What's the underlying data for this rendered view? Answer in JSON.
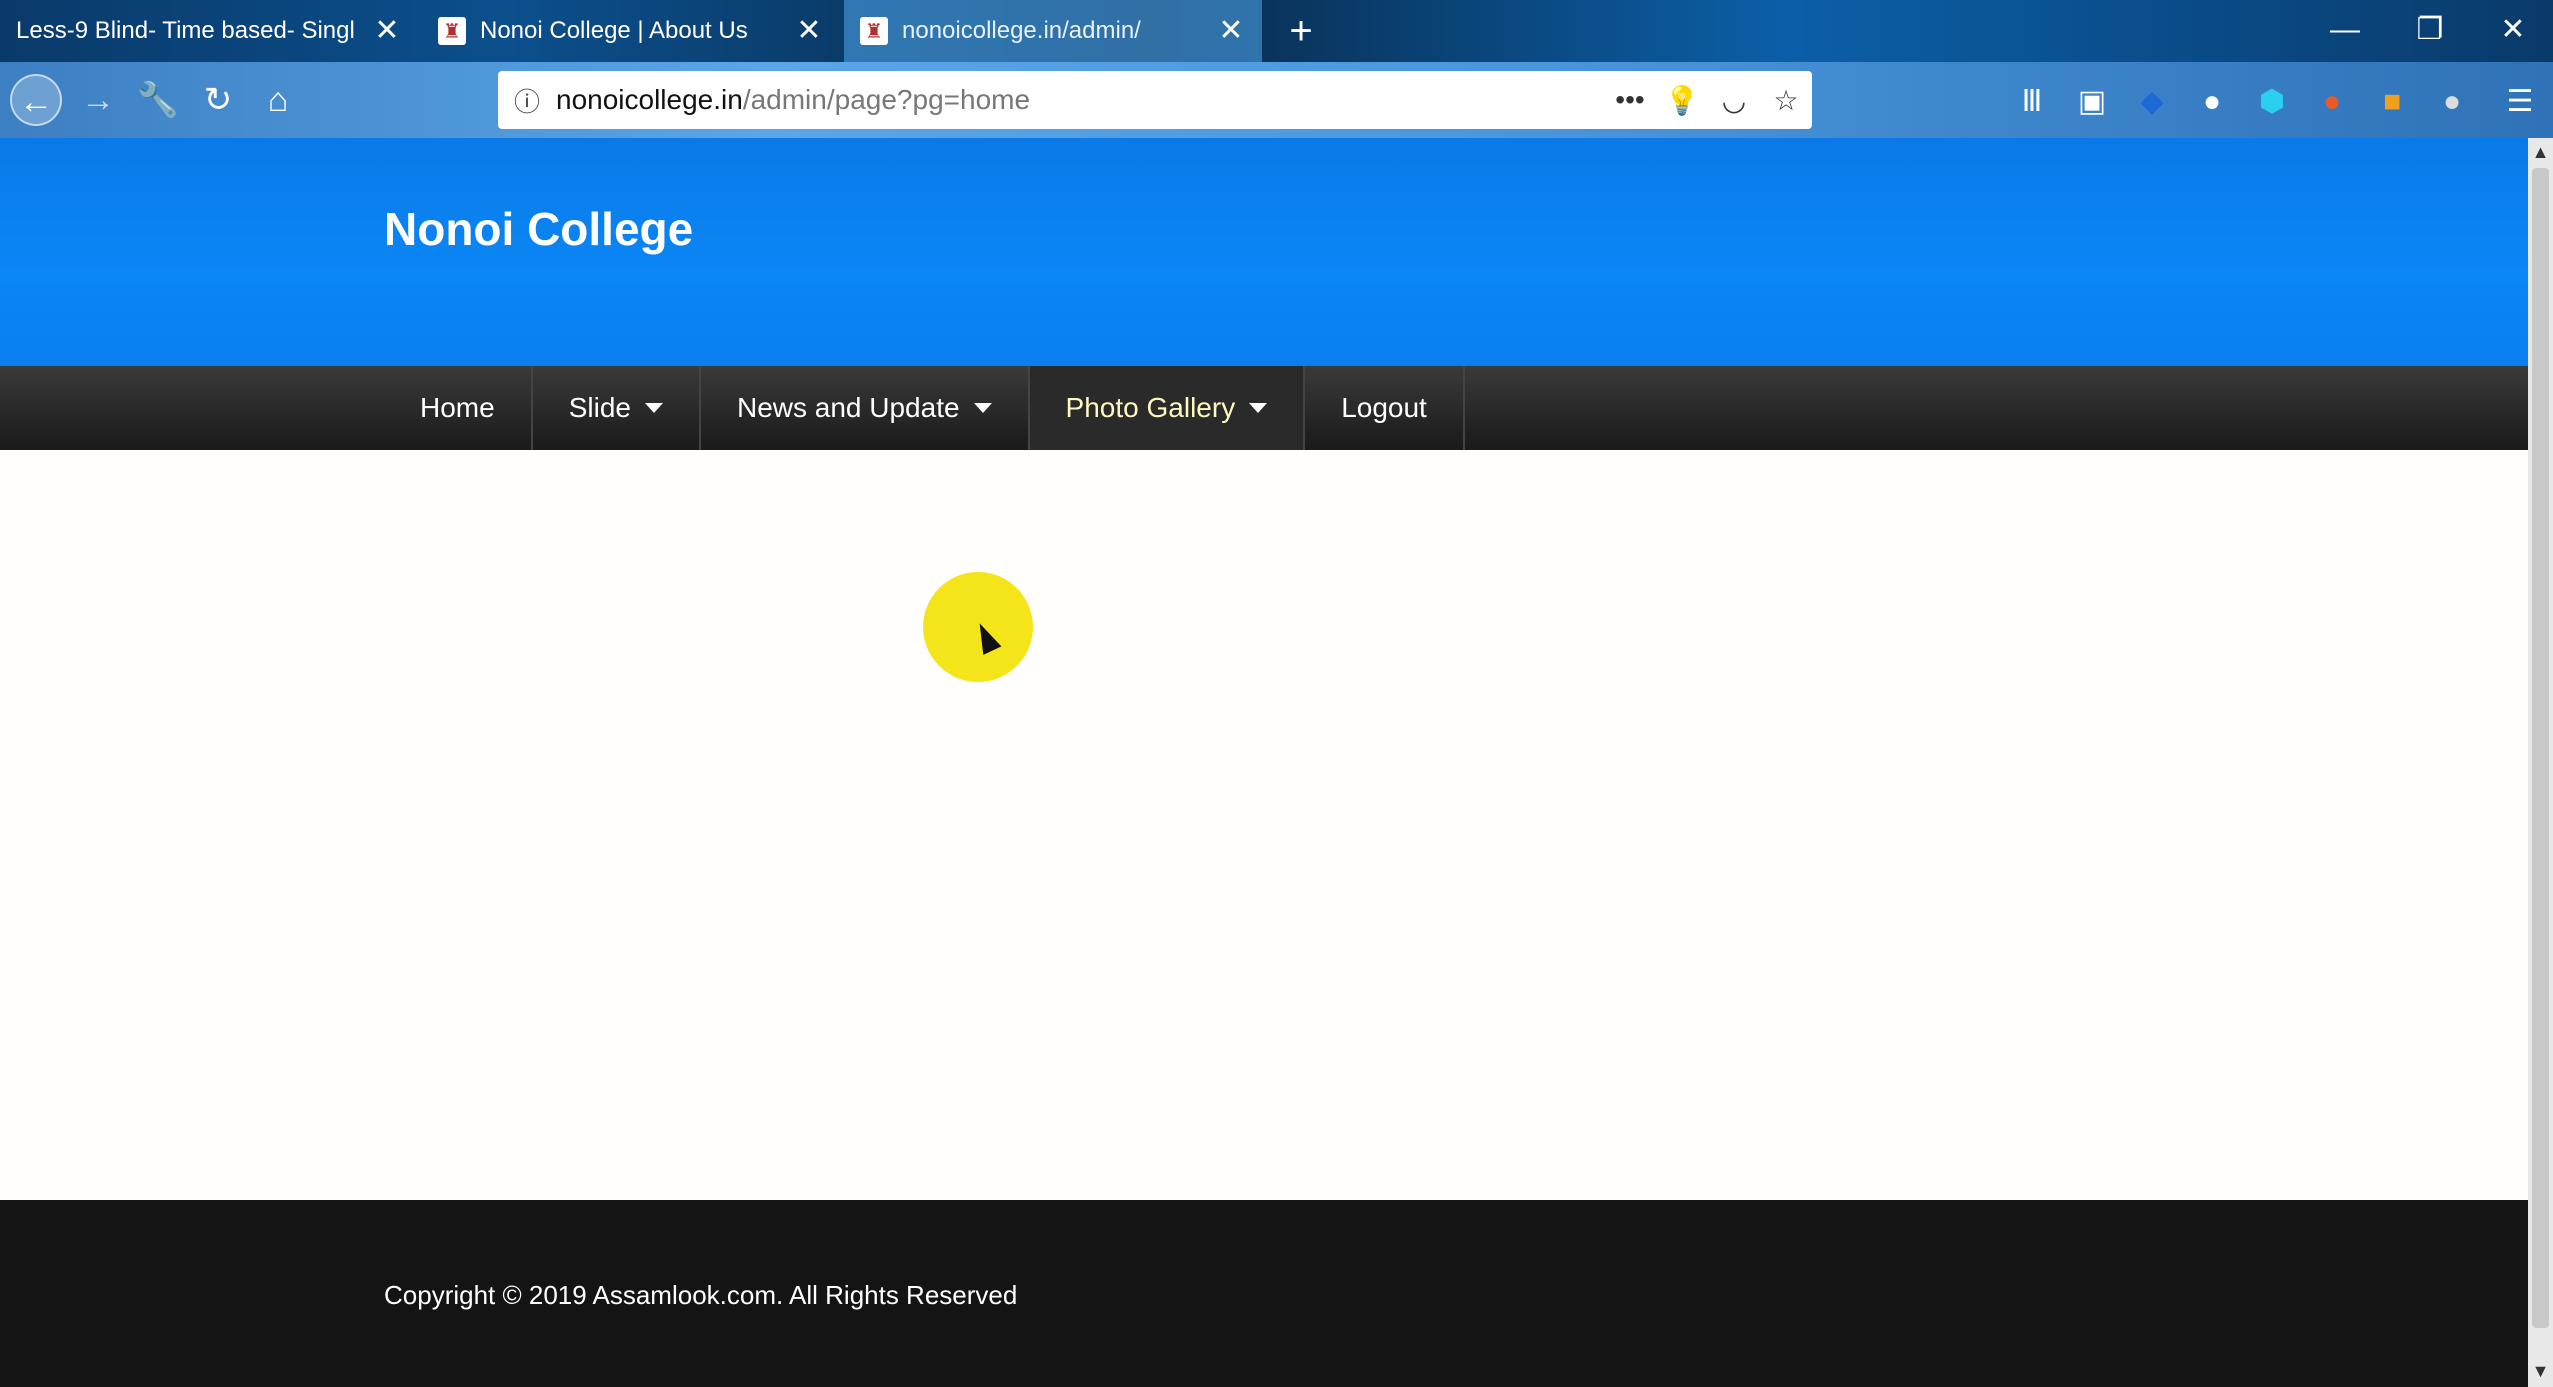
{
  "browser": {
    "tabs": [
      {
        "label": "Less-9 Blind- Time based- Singl",
        "close": "✕"
      },
      {
        "label": "Nonoi College | About Us",
        "close": "✕"
      },
      {
        "label": "nonoicollege.in/admin/",
        "close": "✕"
      }
    ],
    "new_tab": "+",
    "window_controls": {
      "minimize": "—",
      "maximize": "❐",
      "close": "✕"
    },
    "nav": {
      "back": "←",
      "forward": "→",
      "tools": "🔧",
      "reload": "↻",
      "home": "⌂"
    },
    "url": {
      "host": "nonoicollege.in",
      "path": "/admin/page?pg=home"
    },
    "url_actions": {
      "more": "•••",
      "lightbulb": "💡",
      "pocket": "◡",
      "star": "☆"
    },
    "toolbar_icons": [
      "library-icon",
      "sidebar-icon",
      "extension-icon",
      "extension-icon",
      "extension-icon",
      "extension-icon",
      "extension-icon",
      "extension-icon",
      "menu-icon"
    ]
  },
  "site": {
    "title": "Nonoi College",
    "menu": [
      {
        "label": "Home",
        "dropdown": false
      },
      {
        "label": "Slide",
        "dropdown": true
      },
      {
        "label": "News and Update",
        "dropdown": true
      },
      {
        "label": "Photo Gallery",
        "dropdown": true,
        "active": true
      },
      {
        "label": "Logout",
        "dropdown": false
      }
    ],
    "footer": "Copyright © 2019 Assamlook.com. All Rights Reserved"
  },
  "scrollbar": {
    "up": "▲",
    "down": "▼"
  }
}
